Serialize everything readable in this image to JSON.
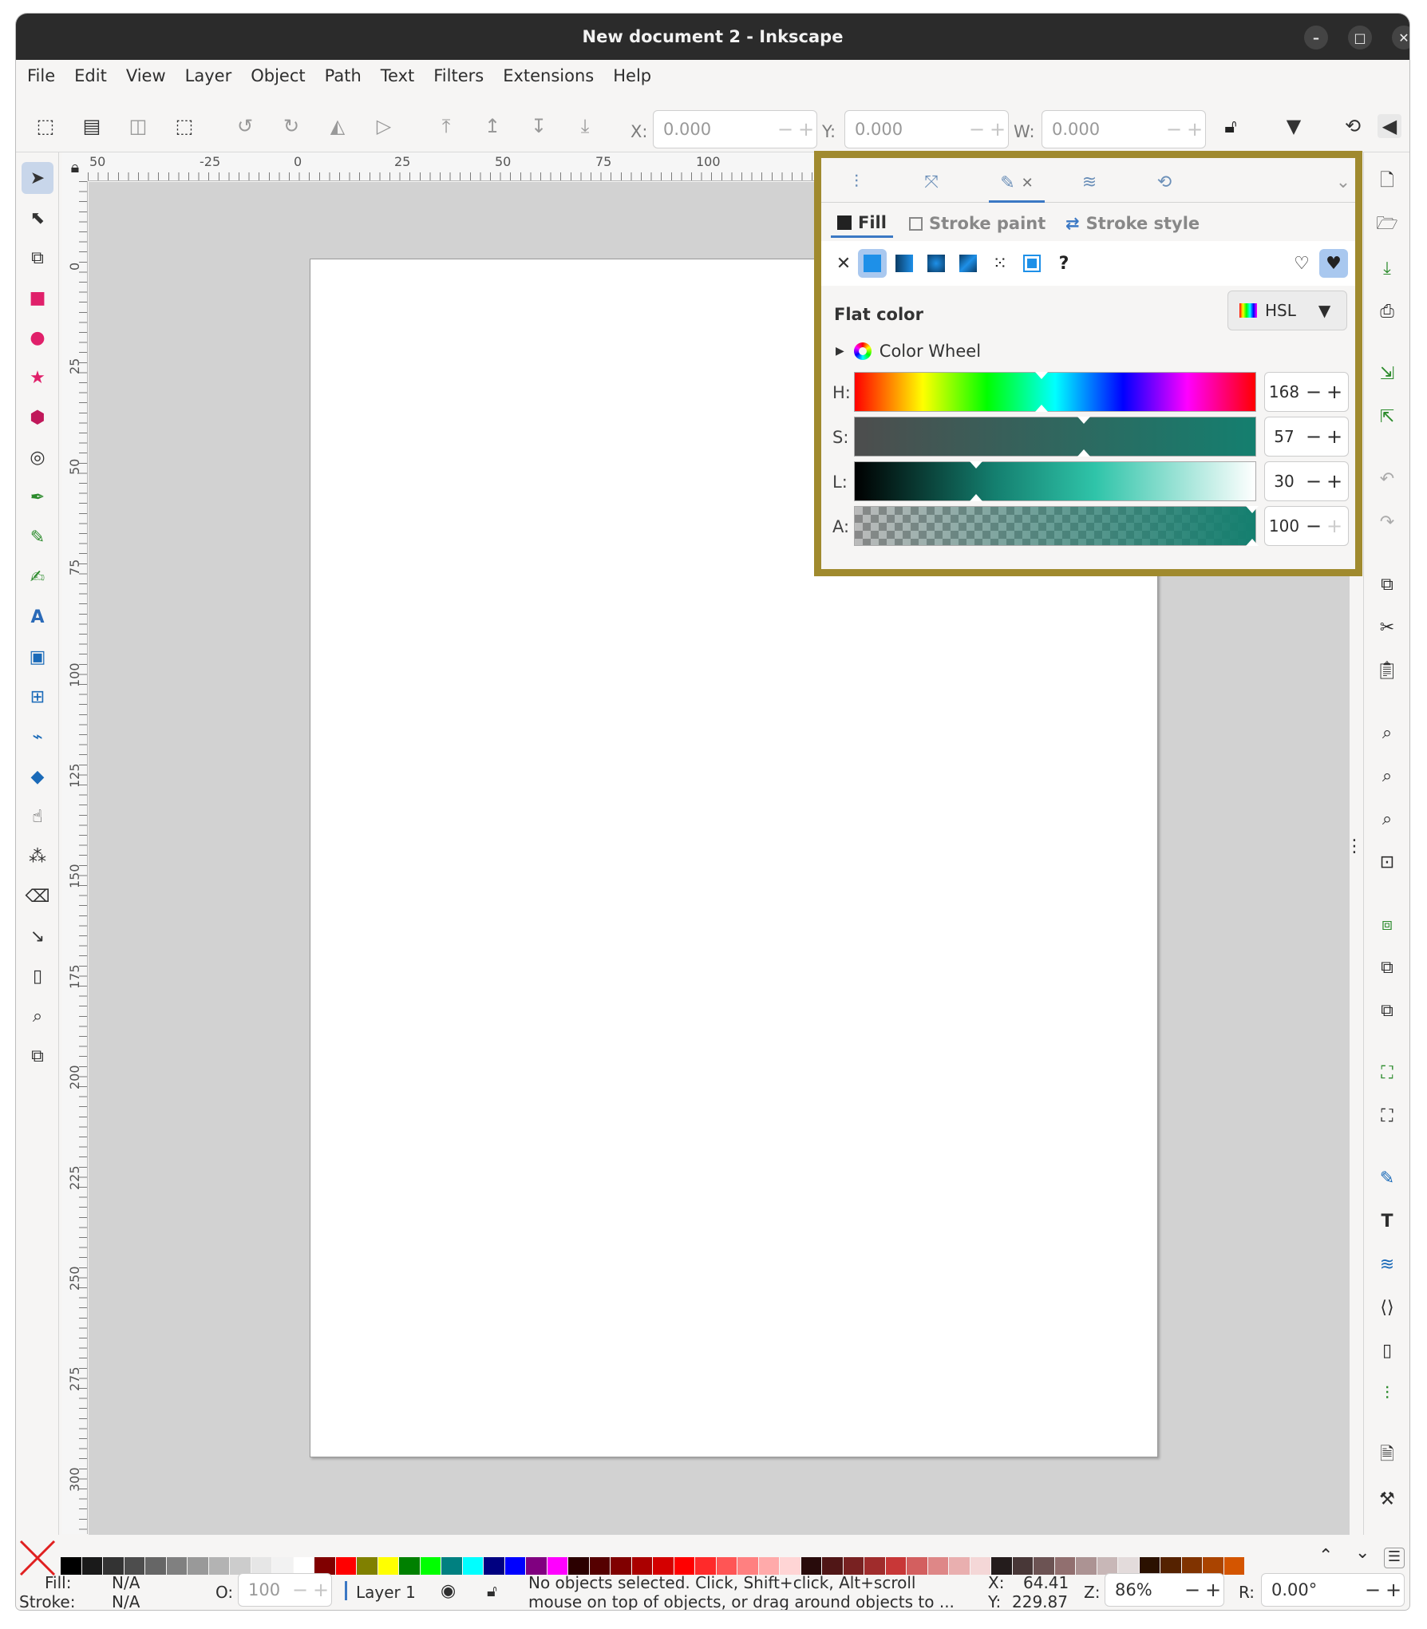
{
  "window": {
    "title": "New document 2 - Inkscape"
  },
  "menu": [
    "File",
    "Edit",
    "View",
    "Layer",
    "Object",
    "Path",
    "Text",
    "Filters",
    "Extensions",
    "Help"
  ],
  "toolbar": {
    "x_label": "X:",
    "x_value": "0.000",
    "y_label": "Y:",
    "y_value": "0.000",
    "w_label": "W:",
    "w_value": "0.000"
  },
  "ruler_h": [
    "50",
    "-25",
    "0",
    "25",
    "50",
    "75",
    "100"
  ],
  "ruler_v": [
    "0",
    "25",
    "50",
    "75",
    "100",
    "125",
    "150",
    "175",
    "200",
    "225",
    "250",
    "275",
    "300"
  ],
  "fill_stroke": {
    "subtabs": {
      "fill": "Fill",
      "stroke_paint": "Stroke paint",
      "stroke_style": "Stroke style"
    },
    "mode_label": "Flat color",
    "color_model": "HSL",
    "color_wheel_label": "Color Wheel",
    "channels": [
      {
        "label": "H:",
        "value": "168"
      },
      {
        "label": "S:",
        "value": "57"
      },
      {
        "label": "L:",
        "value": "30"
      },
      {
        "label": "A:",
        "value": "100"
      }
    ]
  },
  "status": {
    "fill_label": "Fill:",
    "fill_value": "N/A",
    "stroke_label": "Stroke:",
    "stroke_value": "N/A",
    "opacity_label": "O:",
    "opacity_value": "100",
    "layer": "Layer 1",
    "message_line1": "No objects selected. Click, Shift+click, Alt+scroll",
    "message_line2": "mouse on top of objects, or drag around objects to ...",
    "cursor_x_label": "X:",
    "cursor_x": "64.41",
    "cursor_y_label": "Y:",
    "cursor_y": "229.87",
    "zoom_label": "Z:",
    "zoom": "86%",
    "rotate_label": "R:",
    "rotate": "0.00°"
  },
  "colors": {
    "accent_highlight": "#a08a2e",
    "selected_fill": "#147f6f"
  }
}
